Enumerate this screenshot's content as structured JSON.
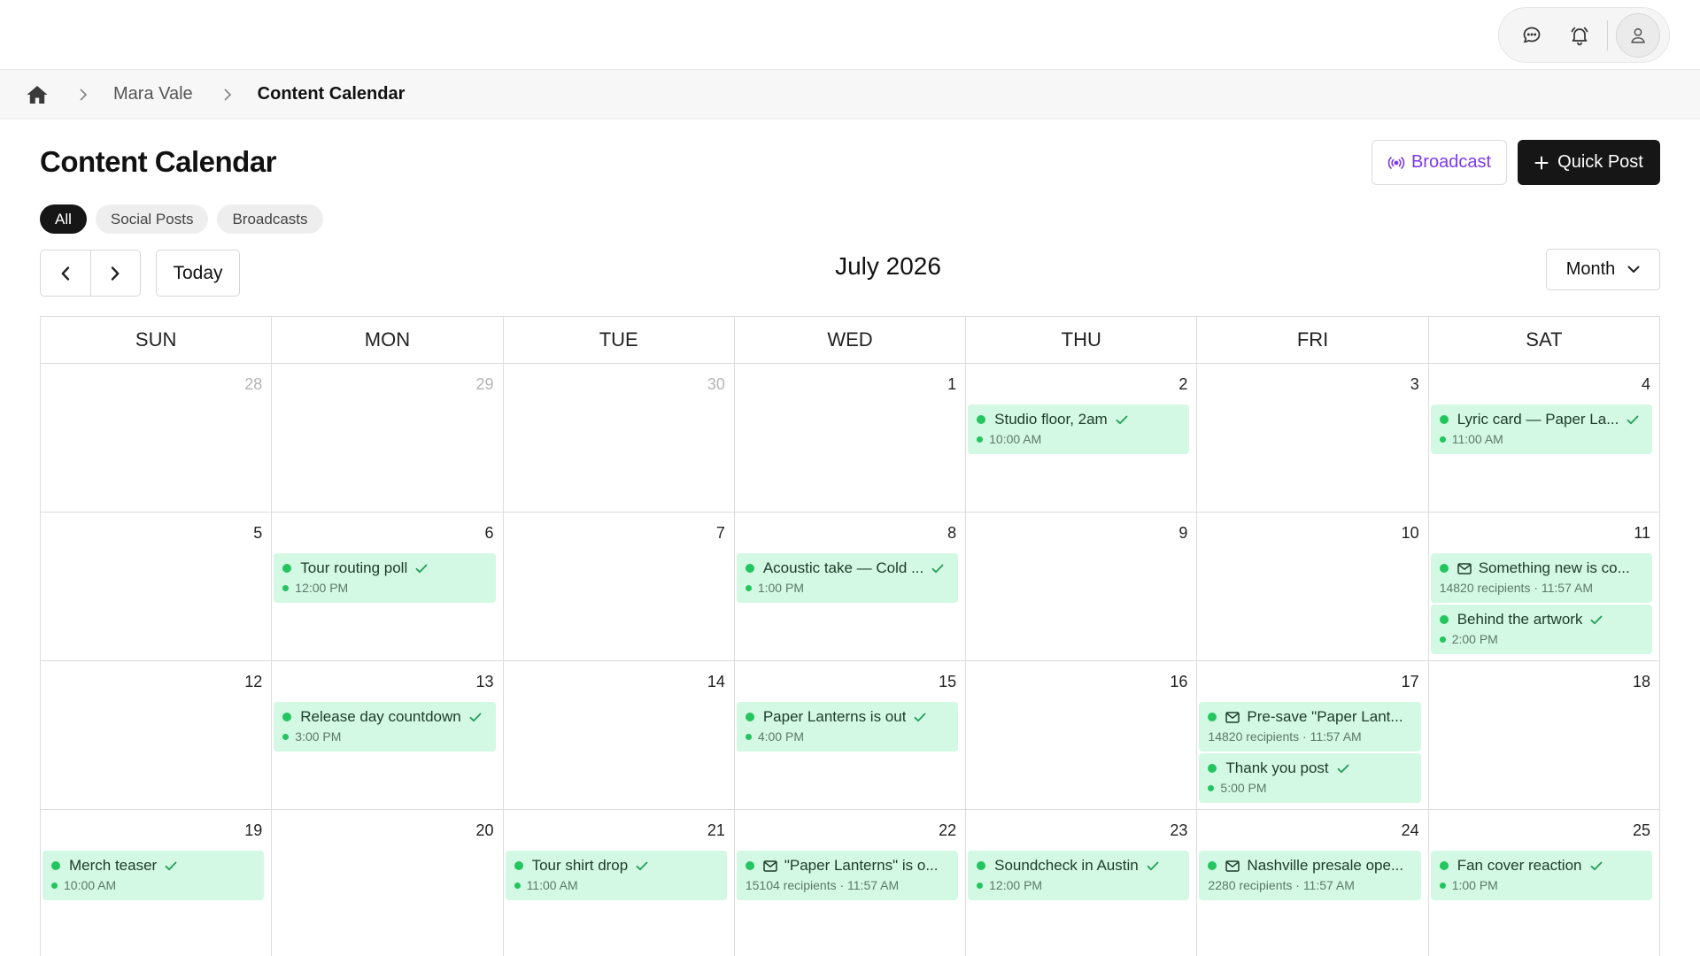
{
  "breadcrumb": {
    "artist": "Mara Vale",
    "current": "Content Calendar"
  },
  "page": {
    "title": "Content Calendar"
  },
  "actions": {
    "broadcast": "Broadcast",
    "quick_post": "Quick Post"
  },
  "filters": [
    "All",
    "Social Posts",
    "Broadcasts"
  ],
  "toolbar": {
    "today": "Today",
    "month_label": "July 2026",
    "view": "Month"
  },
  "colors": {
    "event_bg": "#d3f8e3",
    "event_dot": "#22c55e",
    "broadcast_accent": "#7c3aed",
    "primary": "#161616"
  },
  "calendar": {
    "weekdays": [
      "SUN",
      "MON",
      "TUE",
      "WED",
      "THU",
      "FRI",
      "SAT"
    ],
    "weeks": [
      [
        {
          "day": "28",
          "other": true,
          "events": []
        },
        {
          "day": "29",
          "other": true,
          "events": []
        },
        {
          "day": "30",
          "other": true,
          "events": []
        },
        {
          "day": "1",
          "events": []
        },
        {
          "day": "2",
          "events": [
            {
              "title": "Studio floor, 2am",
              "meta": "10:00 AM",
              "kind": "post"
            }
          ]
        },
        {
          "day": "3",
          "events": []
        },
        {
          "day": "4",
          "events": [
            {
              "title": "Lyric card — Paper La...",
              "meta": "11:00 AM",
              "kind": "post"
            }
          ]
        }
      ],
      [
        {
          "day": "5",
          "events": []
        },
        {
          "day": "6",
          "events": [
            {
              "title": "Tour routing poll",
              "meta": "12:00 PM",
              "kind": "post"
            }
          ]
        },
        {
          "day": "7",
          "events": []
        },
        {
          "day": "8",
          "events": [
            {
              "title": "Acoustic take — Cold ...",
              "meta": "1:00 PM",
              "kind": "post"
            }
          ]
        },
        {
          "day": "9",
          "events": []
        },
        {
          "day": "10",
          "events": []
        },
        {
          "day": "11",
          "events": [
            {
              "title": "Something new is co...",
              "meta": "14820 recipients · 11:57 AM",
              "kind": "broadcast"
            },
            {
              "title": "Behind the artwork",
              "meta": "2:00 PM",
              "kind": "post"
            }
          ]
        }
      ],
      [
        {
          "day": "12",
          "events": []
        },
        {
          "day": "13",
          "events": [
            {
              "title": "Release day countdown",
              "meta": "3:00 PM",
              "kind": "post"
            }
          ]
        },
        {
          "day": "14",
          "events": []
        },
        {
          "day": "15",
          "events": [
            {
              "title": "Paper Lanterns is out",
              "meta": "4:00 PM",
              "kind": "post"
            }
          ]
        },
        {
          "day": "16",
          "events": []
        },
        {
          "day": "17",
          "events": [
            {
              "title": "Pre-save \"Paper Lant...",
              "meta": "14820 recipients · 11:57 AM",
              "kind": "broadcast"
            },
            {
              "title": "Thank you post",
              "meta": "5:00 PM",
              "kind": "post"
            }
          ]
        },
        {
          "day": "18",
          "events": []
        }
      ],
      [
        {
          "day": "19",
          "events": [
            {
              "title": "Merch teaser",
              "meta": "10:00 AM",
              "kind": "post"
            }
          ]
        },
        {
          "day": "20",
          "events": []
        },
        {
          "day": "21",
          "events": [
            {
              "title": "Tour shirt drop",
              "meta": "11:00 AM",
              "kind": "post"
            }
          ]
        },
        {
          "day": "22",
          "events": [
            {
              "title": "\"Paper Lanterns\" is o...",
              "meta": "15104 recipients · 11:57 AM",
              "kind": "broadcast"
            }
          ]
        },
        {
          "day": "23",
          "events": [
            {
              "title": "Soundcheck in Austin",
              "meta": "12:00 PM",
              "kind": "post"
            }
          ]
        },
        {
          "day": "24",
          "events": [
            {
              "title": "Nashville presale ope...",
              "meta": "2280 recipients · 11:57 AM",
              "kind": "broadcast"
            }
          ]
        },
        {
          "day": "25",
          "events": [
            {
              "title": "Fan cover reaction",
              "meta": "1:00 PM",
              "kind": "post"
            }
          ]
        }
      ]
    ]
  }
}
